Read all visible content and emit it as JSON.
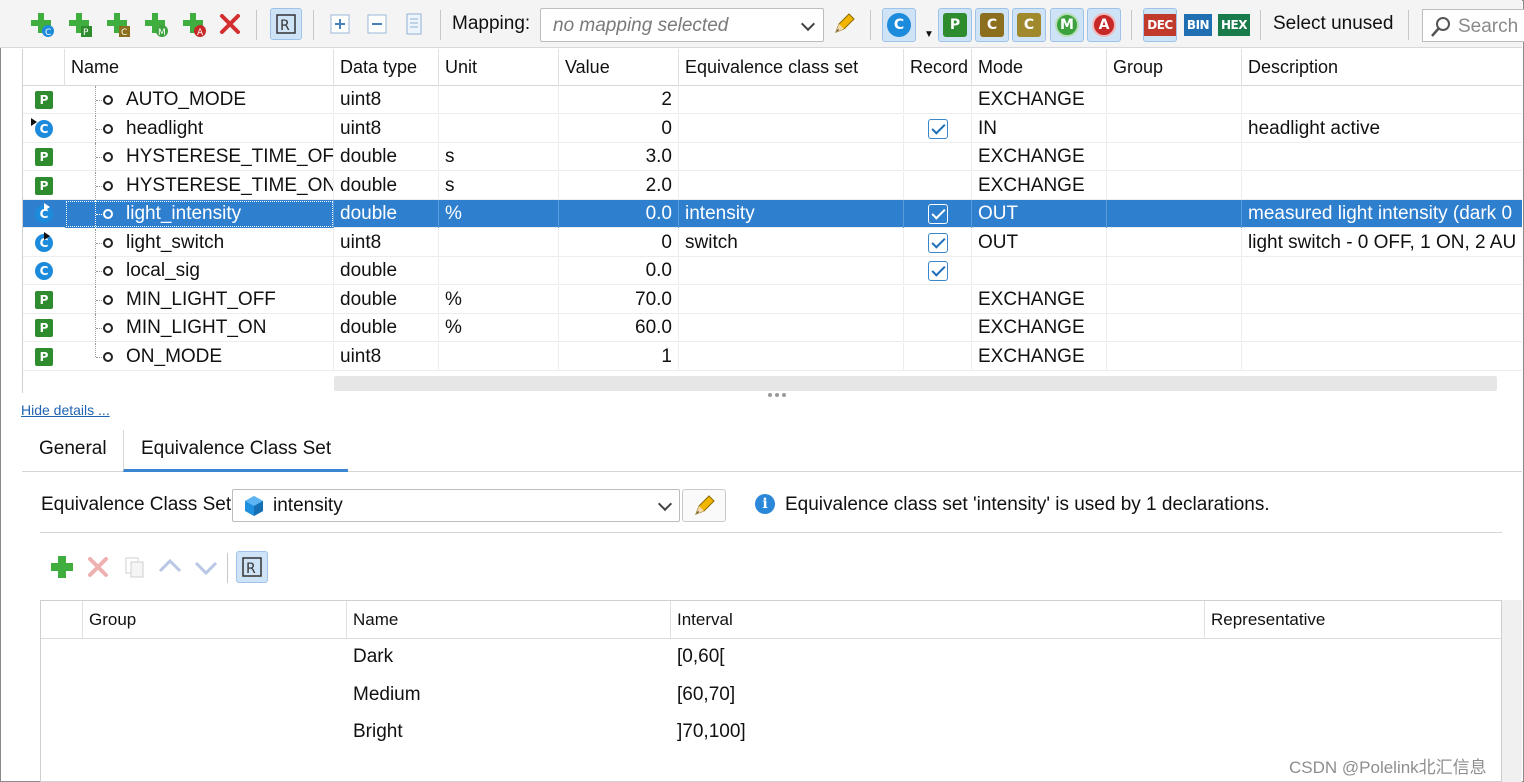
{
  "toolbar": {
    "mapping_label": "Mapping:",
    "mapping_value": "no mapping selected",
    "select_unused_label": "Select unused",
    "search_placeholder": "Search",
    "badges": {
      "c": "C",
      "p": "P",
      "cal": "C",
      "cs": "C",
      "m": "M",
      "a": "A",
      "dec": "DEC",
      "bin": "BIN",
      "hex": "HEX"
    }
  },
  "grid": {
    "columns": [
      "Name",
      "Data type",
      "Unit",
      "Value",
      "Equivalence class set",
      "Record",
      "Mode",
      "Group",
      "Description"
    ],
    "rows": [
      {
        "kind": "P",
        "name": "AUTO_MODE",
        "type": "uint8",
        "unit": "",
        "value": "2",
        "ecs": "",
        "record": false,
        "mode": "EXCHANGE",
        "group": "",
        "desc": ""
      },
      {
        "kind": "C-in",
        "name": "headlight",
        "type": "uint8",
        "unit": "",
        "value": "0",
        "ecs": "",
        "record": true,
        "mode": "IN",
        "group": "",
        "desc": "headlight active"
      },
      {
        "kind": "P",
        "name": "HYSTERESE_TIME_OFF",
        "type": "double",
        "unit": "s",
        "value": "3.0",
        "ecs": "",
        "record": false,
        "mode": "EXCHANGE",
        "group": "",
        "desc": ""
      },
      {
        "kind": "P",
        "name": "HYSTERESE_TIME_ON",
        "type": "double",
        "unit": "s",
        "value": "2.0",
        "ecs": "",
        "record": false,
        "mode": "EXCHANGE",
        "group": "",
        "desc": ""
      },
      {
        "kind": "C-out",
        "name": "light_intensity",
        "type": "double",
        "unit": "%",
        "value": "0.0",
        "ecs": "intensity",
        "record": true,
        "mode": "OUT",
        "group": "",
        "desc": "measured light intensity (dark 0",
        "selected": true
      },
      {
        "kind": "C-out",
        "name": "light_switch",
        "type": "uint8",
        "unit": "",
        "value": "0",
        "ecs": "switch",
        "record": true,
        "mode": "OUT",
        "group": "",
        "desc": "light switch - 0 OFF, 1 ON, 2 AU"
      },
      {
        "kind": "C",
        "name": "local_sig",
        "type": "double",
        "unit": "",
        "value": "0.0",
        "ecs": "",
        "record": true,
        "mode": "",
        "group": "",
        "desc": ""
      },
      {
        "kind": "P",
        "name": "MIN_LIGHT_OFF",
        "type": "double",
        "unit": "%",
        "value": "70.0",
        "ecs": "",
        "record": false,
        "mode": "EXCHANGE",
        "group": "",
        "desc": ""
      },
      {
        "kind": "P",
        "name": "MIN_LIGHT_ON",
        "type": "double",
        "unit": "%",
        "value": "60.0",
        "ecs": "",
        "record": false,
        "mode": "EXCHANGE",
        "group": "",
        "desc": ""
      },
      {
        "kind": "P",
        "name": "ON_MODE",
        "type": "uint8",
        "unit": "",
        "value": "1",
        "ecs": "",
        "record": false,
        "mode": "EXCHANGE",
        "group": "",
        "desc": ""
      }
    ]
  },
  "details": {
    "hide_link": "Hide  details ...",
    "tabs": [
      "General",
      "Equivalence Class Set"
    ],
    "active_tab": "Equivalence Class Set",
    "ecs_label": "Equivalence Class Set:",
    "ecs_value": "intensity",
    "info_text": "Equivalence class set 'intensity' is used by 1 declarations.",
    "table": {
      "columns": [
        "Group",
        "Name",
        "Interval",
        "Representative"
      ],
      "rows": [
        {
          "group": "",
          "name": "Dark",
          "interval": "[0,60[",
          "rep": ""
        },
        {
          "group": "",
          "name": "Medium",
          "interval": "[60,70]",
          "rep": ""
        },
        {
          "group": "",
          "name": "Bright",
          "interval": "]70,100]",
          "rep": ""
        }
      ]
    }
  },
  "watermark": "CSDN @Polelink北汇信息"
}
